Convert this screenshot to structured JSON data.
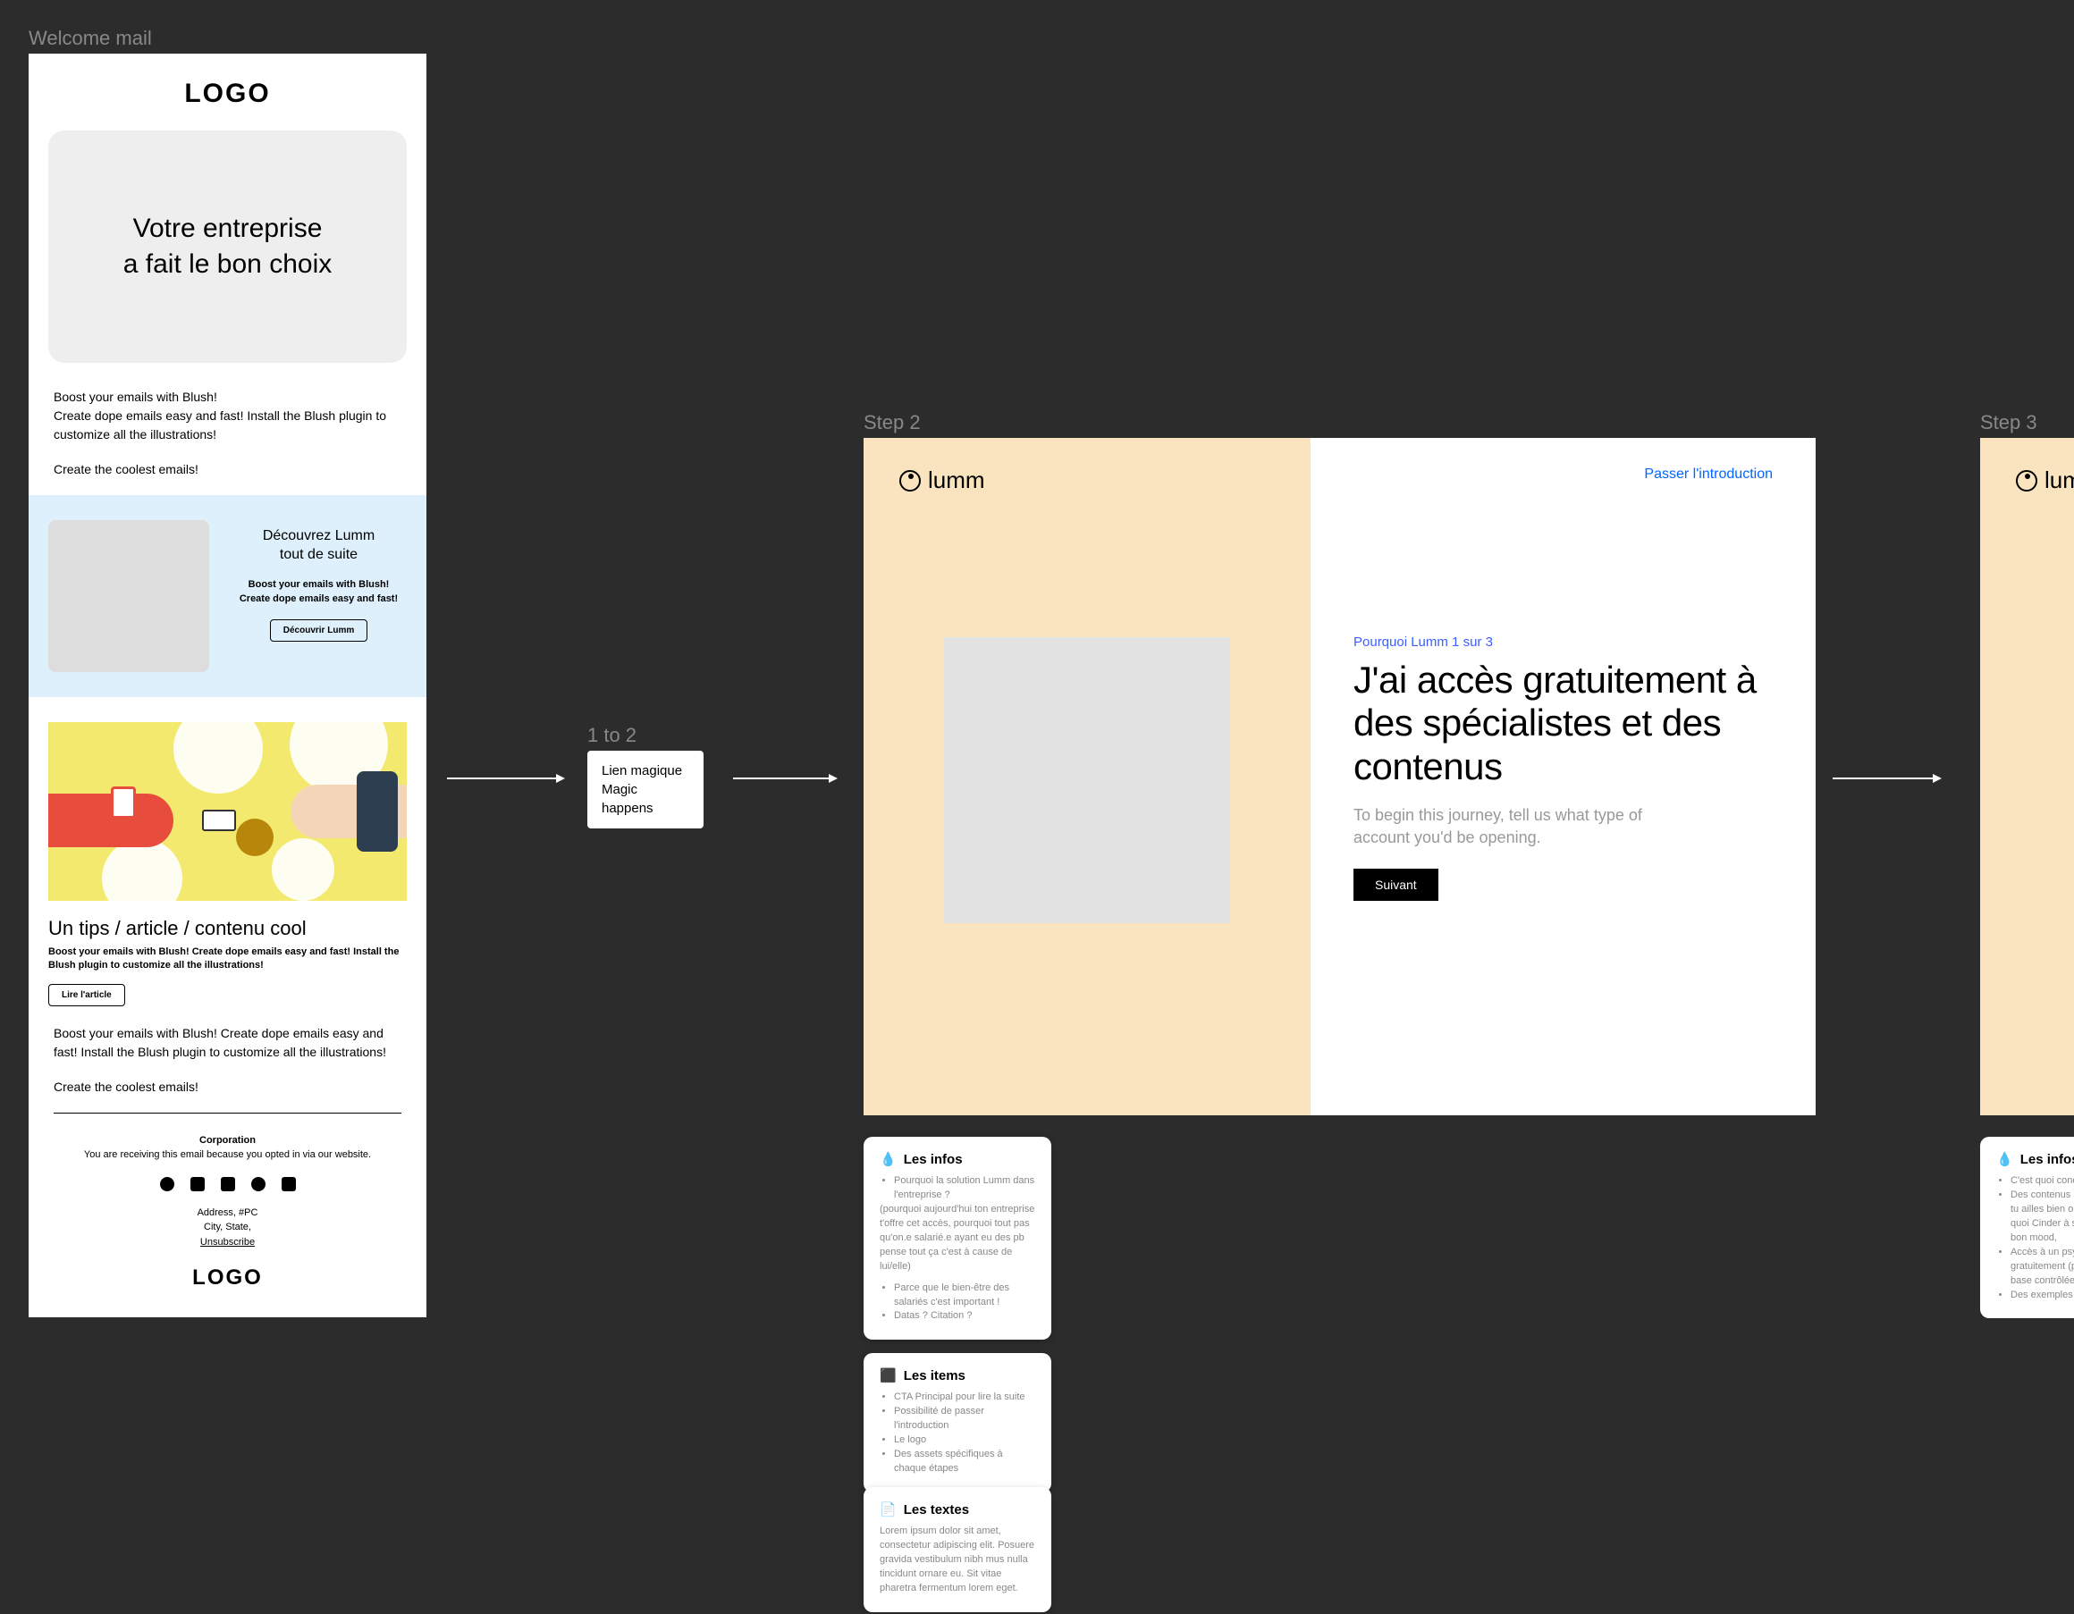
{
  "welcome": {
    "frame_label": "Welcome mail",
    "logo": "LOGO",
    "hero_line1": "Votre entreprise",
    "hero_line2": "a fait le bon choix",
    "body1": "Boost your emails with Blush!",
    "body2": "Create dope emails easy and fast! Install the Blush plugin to customize all the illustrations!",
    "body3": "Create the coolest emails!",
    "discover_title1": "Découvrez Lumm",
    "discover_title2": "tout de suite",
    "discover_sub1": "Boost your emails with Blush!",
    "discover_sub2": "Create dope emails easy and fast!",
    "discover_btn": "Découvrir Lumm",
    "article_title": "Un tips / article / contenu cool",
    "article_sub": "Boost your emails with Blush! Create dope emails easy and fast! Install the Blush plugin to customize all the illustrations!",
    "article_btn": "Lire l'article",
    "body_repeat1": "Boost your emails with Blush! Create dope emails easy and fast! Install the Blush plugin to customize all the illustrations!",
    "body_repeat2": "Create the coolest emails!",
    "footer_corp": "Corporation",
    "footer_opt": "You are receiving this email because you opted in via our website.",
    "footer_address": "Address, #PC",
    "footer_city": "City, State,",
    "footer_unsub": "Unsubscribe"
  },
  "transition": {
    "frame_label": "1 to 2",
    "line1": "Lien magique",
    "line2": "Magic happens"
  },
  "step2": {
    "frame_label": "Step 2",
    "brand": "lumm",
    "skip": "Passer l'introduction",
    "counter": "Pourquoi Lumm 1 sur 3",
    "heading": "J'ai accès gratuitement à des spécialistes et des contenus",
    "desc": "To begin this journey, tell us what type of account you'd be opening.",
    "next": "Suivant"
  },
  "step3": {
    "frame_label": "Step 3",
    "brand": "lumm"
  },
  "card_infos": {
    "title": "Les infos",
    "items": [
      "Pourquoi la solution Lumm dans l'entreprise ?"
    ],
    "sub1": "(pourquoi aujourd'hui ton entreprise t'offre cet accès, pourquoi tout pas qu'on.e salarié.e ayant eu des pb pense tout ça c'est à cause de lui/elle)",
    "items2": [
      "Parce que le bien-être des salariés c'est important !",
      "Datas ? Citation ?"
    ]
  },
  "card_items": {
    "title": "Les items",
    "items": [
      "CTA Principal pour lire la suite",
      "Possibilité de passer l'introduction",
      "Le logo",
      "Des assets spécifiques à chaque étapes"
    ]
  },
  "card_textes": {
    "title": "Les textes",
    "body": "Lorem ipsum dolor sit amet, consectetur adipiscing elit. Posuere gravida vestibulum nibh mus nulla tincidunt ornare eu. Sit vitae pharetra fermentum lorem eget."
  },
  "card_infos3": {
    "title": "Les infos",
    "items": [
      "C'est quoi concrètement Lumm",
      "Des contenus adaptés à ce que tu ailles bien ou moins bien, quoi Cinder à son quotidien, bon mood,",
      "Accès à un psychologue gratuitement (pas encore la base contrôlée de créativité",
      "Des exemples de"
    ]
  }
}
